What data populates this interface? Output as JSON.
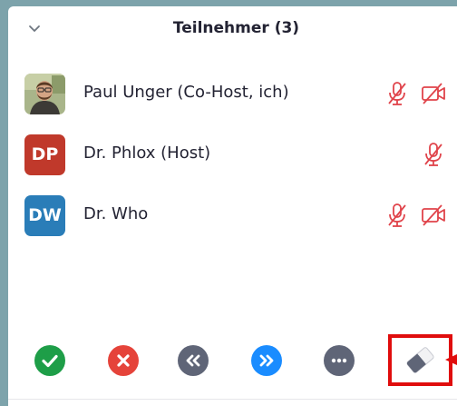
{
  "panel": {
    "title": "Teilnehmer (3)",
    "collapse_icon": "chevron-down-icon"
  },
  "participants": [
    {
      "name": "Paul Unger (Co-Host, ich)",
      "avatar_type": "photo",
      "mic": "muted",
      "video": "off"
    },
    {
      "name": "Dr. Phlox (Host)",
      "initials": "DP",
      "avatar_color": "#c0392b",
      "mic": "muted"
    },
    {
      "name": "Dr. Who",
      "initials": "DW",
      "avatar_color": "#2a7db8",
      "mic": "muted",
      "video": "off"
    }
  ],
  "footer_buttons": [
    {
      "name": "yes-icon",
      "color": "#1e9e48"
    },
    {
      "name": "no-icon",
      "color": "#e5433a"
    },
    {
      "name": "go-slower-icon",
      "color": "#5f6577"
    },
    {
      "name": "go-faster-icon",
      "color": "#1a8cff"
    },
    {
      "name": "more-icon",
      "color": "#5f6577"
    },
    {
      "name": "clear-all-eraser-icon",
      "color": "#5f6577"
    }
  ],
  "colors": {
    "muted_red": "#e0434a",
    "highlight_red": "#e00d0d",
    "background": "#7da3ab"
  }
}
